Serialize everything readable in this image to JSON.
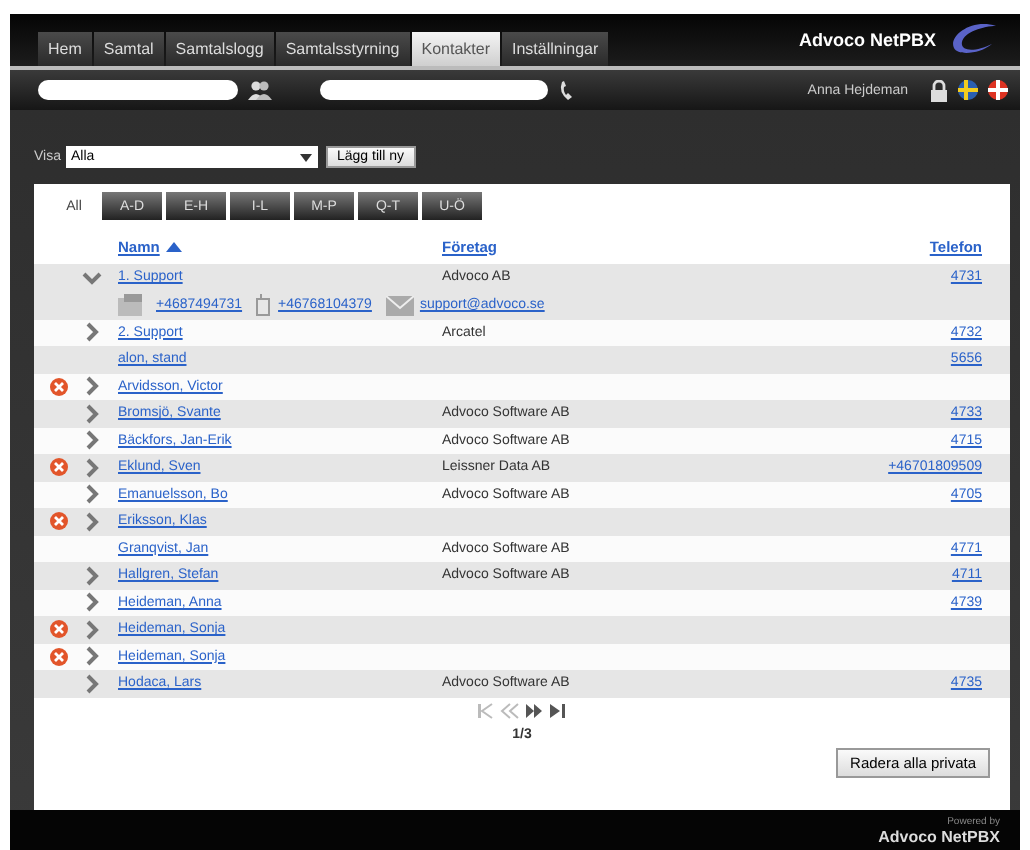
{
  "nav_tabs": [
    {
      "label": "Hem",
      "selected": false
    },
    {
      "label": "Samtal",
      "selected": false
    },
    {
      "label": "Samtalslogg",
      "selected": false
    },
    {
      "label": "Samtalsstyrning",
      "selected": false
    },
    {
      "label": "Kontakter",
      "selected": true
    },
    {
      "label": "Inställningar",
      "selected": false
    }
  ],
  "brand": "Advoco NetPBX",
  "user_name": "Anna Hejdeman",
  "filter": {
    "label": "Visa",
    "value": "Alla",
    "add_button": "Lägg till ny"
  },
  "letter_tabs": [
    {
      "label": "All",
      "selected": true
    },
    {
      "label": "A-D",
      "selected": false
    },
    {
      "label": "E-H",
      "selected": false
    },
    {
      "label": "I-L",
      "selected": false
    },
    {
      "label": "M-P",
      "selected": false
    },
    {
      "label": "Q-T",
      "selected": false
    },
    {
      "label": "U-Ö",
      "selected": false
    }
  ],
  "columns": [
    {
      "label": "Namn",
      "sorted": true
    },
    {
      "label": "Företag",
      "sorted": false
    },
    {
      "label": "Telefon",
      "sorted": false
    }
  ],
  "rows": [
    {
      "name": "1. Support",
      "company": "Advoco AB",
      "phone": "4731",
      "warning": false,
      "kind": "expandable",
      "expanded": true,
      "details": {
        "phone": "+4687494731",
        "mobile": "+46768104379",
        "email": "support@advoco.se"
      }
    },
    {
      "name": "2. Support",
      "company": "Arcatel",
      "phone": "4732",
      "warning": false,
      "kind": "expandable",
      "expanded": false
    },
    {
      "name": "alon, stand",
      "phone": "5656",
      "warning": false,
      "kind": "plain"
    },
    {
      "name": "Arvidsson, Victor",
      "warning": true,
      "kind": "expandable",
      "expanded": false
    },
    {
      "name": "Bromsjö, Svante",
      "company": "Advoco Software AB",
      "phone": "4733",
      "warning": false,
      "kind": "expandable",
      "expanded": false
    },
    {
      "name": "Bäckfors, Jan-Erik",
      "company": "Advoco Software AB",
      "phone": "4715",
      "warning": false,
      "kind": "expandable",
      "expanded": false
    },
    {
      "name": "Eklund, Sven",
      "company": "Leissner Data AB",
      "phone": "+46701809509",
      "warning": true,
      "kind": "expandable",
      "expanded": false
    },
    {
      "name": "Emanuelsson, Bo",
      "company": "Advoco Software AB",
      "phone": "4705",
      "warning": false,
      "kind": "expandable",
      "expanded": false
    },
    {
      "name": "Eriksson, Klas",
      "warning": true,
      "kind": "expandable",
      "expanded": false
    },
    {
      "name": "Granqvist, Jan",
      "company": "Advoco Software AB",
      "phone": "4771",
      "warning": false,
      "kind": "plain"
    },
    {
      "name": "Hallgren, Stefan",
      "company": "Advoco Software AB",
      "phone": "4711",
      "warning": false,
      "kind": "expandable",
      "expanded": false
    },
    {
      "name": "Heideman, Anna",
      "phone": "4739",
      "warning": false,
      "kind": "expandable",
      "expanded": false
    },
    {
      "name": "Heideman, Sonja",
      "warning": true,
      "kind": "expandable",
      "expanded": false
    },
    {
      "name": "Heideman, Sonja",
      "warning": true,
      "kind": "expandable",
      "expanded": false
    },
    {
      "name": "Hodaca, Lars",
      "company": "Advoco Software AB",
      "phone": "4735",
      "warning": false,
      "kind": "expandable",
      "expanded": false
    }
  ],
  "pager": {
    "first_disabled": true,
    "prev_disabled": true,
    "next_disabled": false,
    "last_disabled": false,
    "page": "1/3"
  },
  "delete_button": "Radera alla privata",
  "footer": {
    "powered_by": "Powered by",
    "brand": "Advoco NetPBX"
  }
}
